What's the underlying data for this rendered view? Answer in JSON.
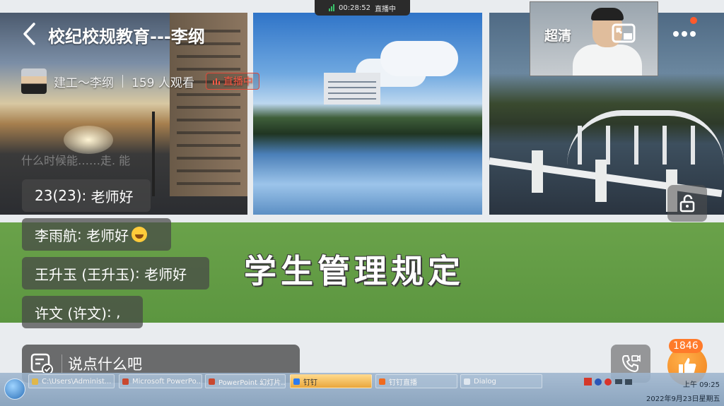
{
  "status_bar": {
    "elapsed": "00:28:52",
    "state": "直播中"
  },
  "live": {
    "title": "校纪校规教育---李纲",
    "host": "建工～李纲",
    "viewers": "159 人观看",
    "live_badge": "直播中",
    "quality": "超清"
  },
  "slide": {
    "title": "学生管理规定"
  },
  "chat": {
    "ghost": "什么时候能……走. 能",
    "comments": [
      {
        "name": "23(23)",
        "text": "老师好"
      },
      {
        "name": "李雨航",
        "text": "老师好"
      },
      {
        "name": "王升玉 (王升玉)",
        "text": "老师好"
      },
      {
        "name": "许文 (许文)",
        "text": ","
      }
    ],
    "input_placeholder": "说点什么吧"
  },
  "likes": {
    "count": "1846"
  },
  "taskbar": {
    "items": [
      {
        "label": "C:\\Users\\Administ...",
        "color": "#e0b74a"
      },
      {
        "label": "Microsoft PowerPo...",
        "color": "#c9482f"
      },
      {
        "label": "PowerPoint 幻灯片...",
        "color": "#c9482f"
      },
      {
        "label": "钉钉",
        "color": "#2d7cf0"
      },
      {
        "label": "钉钉直播",
        "color": "#f06a1e"
      },
      {
        "label": "Dialog",
        "color": "#dfe7ef"
      }
    ],
    "time": "上午 09:25",
    "date": "2022年9月23日星期五"
  }
}
